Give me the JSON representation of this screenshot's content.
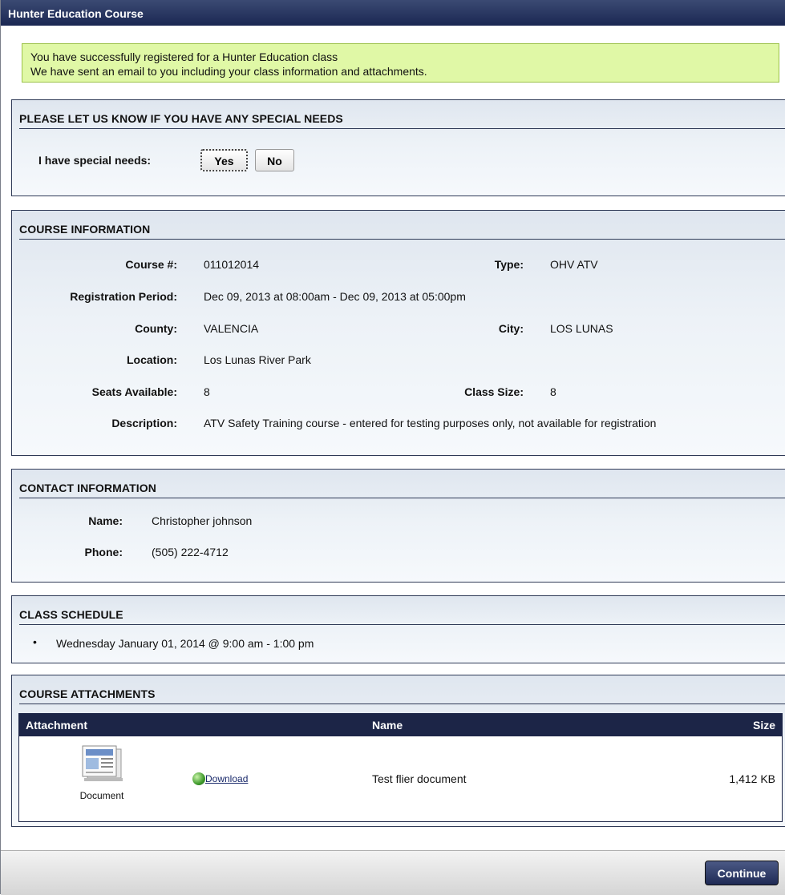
{
  "window": {
    "title": "Hunter Education Course"
  },
  "success": {
    "line1": "You have successfully registered for a Hunter Education class",
    "line2": "We have sent an email to you including your class information and attachments."
  },
  "special_needs": {
    "title": "PLEASE LET US KNOW IF YOU HAVE ANY SPECIAL NEEDS",
    "label": "I have special needs:",
    "yes": "Yes",
    "no": "No",
    "selected": "Yes"
  },
  "course": {
    "title": "COURSE INFORMATION",
    "course_no_label": "Course #:",
    "course_no": "011012014",
    "type_label": "Type:",
    "type": "OHV ATV",
    "reg_label": "Registration Period:",
    "reg": "Dec 09, 2013 at 08:00am - Dec 09, 2013 at 05:00pm",
    "county_label": "County:",
    "county": "VALENCIA",
    "city_label": "City:",
    "city": "LOS LUNAS",
    "location_label": "Location:",
    "location": "Los Lunas River Park",
    "seats_label": "Seats Available:",
    "seats": "8",
    "size_label": "Class Size:",
    "size": "8",
    "desc_label": "Description:",
    "desc": "ATV Safety Training course - entered for testing purposes only, not available for registration"
  },
  "contact": {
    "title": "CONTACT INFORMATION",
    "name_label": "Name:",
    "name": "Christopher johnson",
    "phone_label": "Phone:",
    "phone": "(505) 222-4712"
  },
  "schedule": {
    "title": "CLASS SCHEDULE",
    "items": [
      "Wednesday January 01, 2014 @ 9:00 am - 1:00 pm"
    ]
  },
  "attachments": {
    "title": "COURSE ATTACHMENTS",
    "columns": [
      "Attachment",
      "Name",
      "Size"
    ],
    "rows": [
      {
        "icon_caption": "Document",
        "download": "Download",
        "name": "Test flier document",
        "size": "1,412 KB"
      }
    ]
  },
  "footer": {
    "continue": "Continue"
  },
  "colors": {
    "header": "#1c2547",
    "success_bg": "#e0f8a6",
    "panel_bg": "#e9eef5"
  }
}
